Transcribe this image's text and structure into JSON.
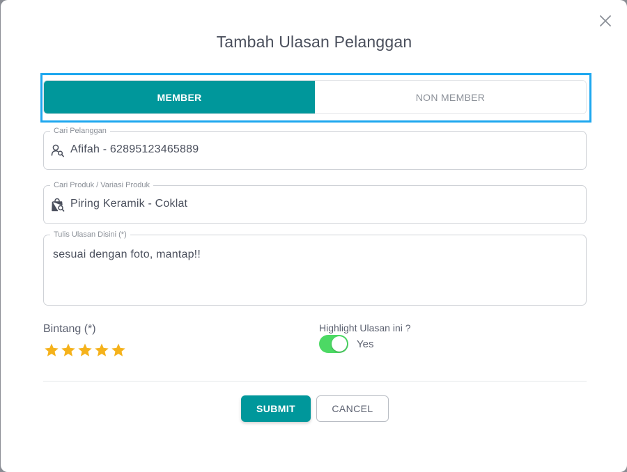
{
  "dialog": {
    "title": "Tambah Ulasan Pelanggan",
    "close_icon": "close-icon"
  },
  "tabs": [
    {
      "label": "MEMBER",
      "active": true
    },
    {
      "label": "NON MEMBER",
      "active": false
    }
  ],
  "customer_field": {
    "label": "Cari Pelanggan",
    "value": "Afifah - 62895123465889",
    "icon": "user-search-icon"
  },
  "product_field": {
    "label": "Cari Produk / Variasi Produk",
    "value": "Piring Keramik - Coklat",
    "icon": "bag-search-icon"
  },
  "review_field": {
    "label": "Tulis Ulasan Disini (*)",
    "value": "sesuai dengan foto, mantap!!"
  },
  "rating": {
    "label": "Bintang (*)",
    "value": 5,
    "max": 5,
    "color": "#f5b21b"
  },
  "highlight": {
    "label": "Highlight Ulasan ini ?",
    "toggle_on": true,
    "toggle_text": "Yes",
    "color": "#4cd964"
  },
  "actions": {
    "submit_label": "SUBMIT",
    "cancel_label": "CANCEL"
  },
  "colors": {
    "accent": "#00979b",
    "focus_outline": "#1da7ef"
  }
}
